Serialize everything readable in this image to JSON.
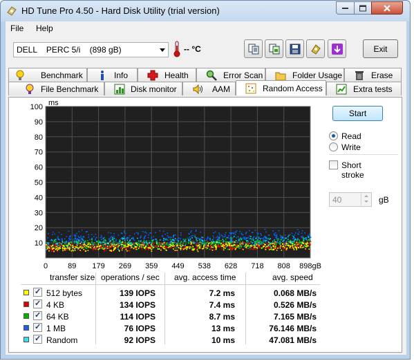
{
  "window": {
    "title": "HD Tune Pro 4.50 - Hard Disk Utility (trial version)"
  },
  "menu": {
    "file": "File",
    "help": "Help"
  },
  "toolbar": {
    "drive_name": "DELL    PERC 5/i",
    "drive_size": "(898 gB)",
    "temperature": "-- °C",
    "exit_label": "Exit",
    "icons": [
      "copy-info-icon",
      "copy-screenshot-icon",
      "save-icon",
      "options-icon",
      "download-icon"
    ]
  },
  "tabs_top": [
    {
      "label": "Benchmark",
      "icon": "lightbulb-icon"
    },
    {
      "label": "Info",
      "icon": "info-icon"
    },
    {
      "label": "Health",
      "icon": "health-cross-icon"
    },
    {
      "label": "Error Scan",
      "icon": "magnifier-icon"
    },
    {
      "label": "Folder Usage",
      "icon": "folder-icon"
    },
    {
      "label": "Erase",
      "icon": "trash-icon"
    }
  ],
  "tabs_bottom": [
    {
      "label": "File Benchmark",
      "icon": "file-benchmark-icon"
    },
    {
      "label": "Disk monitor",
      "icon": "disk-monitor-icon"
    },
    {
      "label": "AAM",
      "icon": "speaker-icon"
    },
    {
      "label": "Random Access",
      "icon": "random-access-icon",
      "active": true
    },
    {
      "label": "Extra tests",
      "icon": "extra-tests-icon"
    }
  ],
  "controls": {
    "start_label": "Start",
    "read_label": "Read",
    "write_label": "Write",
    "mode": "read",
    "short_stroke_label": "Short stroke",
    "short_stroke_checked": false,
    "short_stroke_value": "40",
    "short_stroke_unit": "gB"
  },
  "chart_data": {
    "type": "scatter",
    "y_unit": "ms",
    "ylim": [
      0,
      100
    ],
    "y_ticks": [
      "100",
      "90",
      "80",
      "70",
      "60",
      "50",
      "40",
      "30",
      "20",
      "10"
    ],
    "x_ticks": [
      "0",
      "89",
      "179",
      "269",
      "359",
      "449",
      "538",
      "628",
      "718",
      "808",
      "898gB"
    ],
    "xlim": [
      0,
      898
    ],
    "grid": true,
    "background": "#202020",
    "series": [
      {
        "name": "512 bytes",
        "color": "#ffff00",
        "avg_ms": 7.2
      },
      {
        "name": "4 KB",
        "color": "#ff0000",
        "avg_ms": 7.4
      },
      {
        "name": "64 KB",
        "color": "#00c800",
        "avg_ms": 8.7
      },
      {
        "name": "1 MB",
        "color": "#0064ff",
        "avg_ms": 13
      },
      {
        "name": "Random",
        "color": "#00dcff",
        "avg_ms": 10
      }
    ]
  },
  "results": {
    "headers": [
      "transfer size",
      "operations / sec",
      "avg. access time",
      "avg. speed"
    ],
    "rows": [
      {
        "name": "512 bytes",
        "color": "#ffff00",
        "ops": "139 IOPS",
        "access": "7.2 ms",
        "speed": "0.068 MB/s"
      },
      {
        "name": "4 KB",
        "color": "#e00000",
        "ops": "134 IOPS",
        "access": "7.4 ms",
        "speed": "0.526 MB/s"
      },
      {
        "name": "64 KB",
        "color": "#00b400",
        "ops": "114 IOPS",
        "access": "8.7 ms",
        "speed": "7.165 MB/s"
      },
      {
        "name": "1 MB",
        "color": "#1e5fd6",
        "ops": "76 IOPS",
        "access": "13 ms",
        "speed": "76.146 MB/s"
      },
      {
        "name": "Random",
        "color": "#3cd8f0",
        "ops": "92 IOPS",
        "access": "10 ms",
        "speed": "47.081 MB/s"
      }
    ]
  }
}
